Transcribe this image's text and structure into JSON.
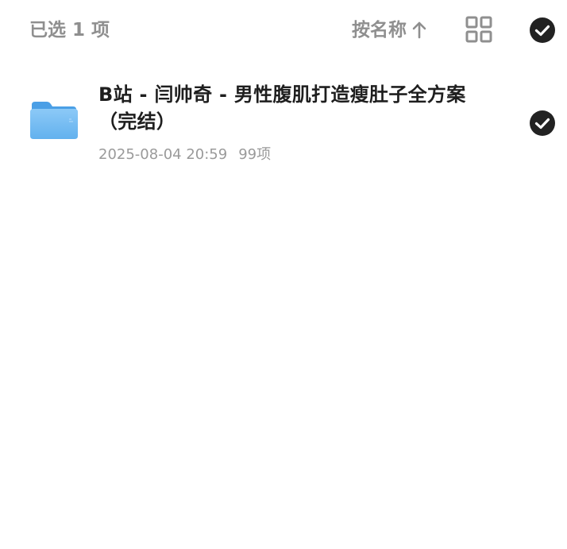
{
  "header": {
    "selected_count_label": "已选 1 项",
    "sort_label": "按名称",
    "sort_direction_icon": "arrow-up-icon",
    "view_toggle_icon": "grid-view-icon",
    "select_all_icon": "check-circle-icon"
  },
  "files": [
    {
      "name": "B站 - 闫帅奇 - 男性腹肌打造瘦肚子全方案（完结）",
      "date": "2025-08-04 20:59",
      "item_count": "99项",
      "icon": "folder-icon",
      "selected": true
    }
  ],
  "colors": {
    "muted_text": "#8f8f8f",
    "title_text": "#1e1e1e",
    "meta_text": "#9a9a9a",
    "check_fill": "#222222",
    "folder_blue": "#5aaef0"
  }
}
